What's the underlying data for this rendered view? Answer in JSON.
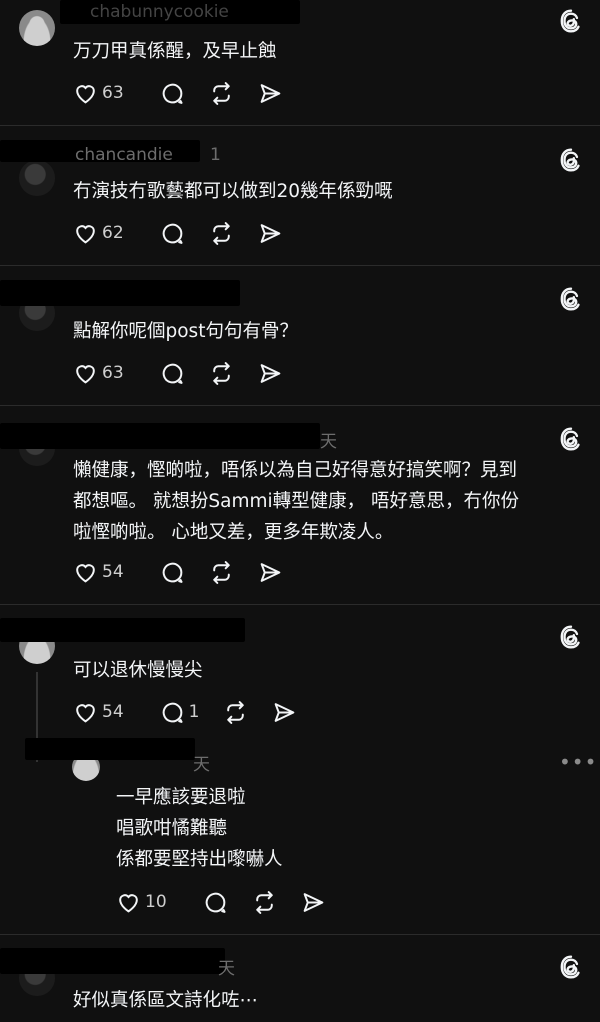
{
  "comments": [
    {
      "handle": "chabunnycookie",
      "time": "",
      "text": [
        "万刀甲真係醒，及早止蝕"
      ],
      "likes": "63",
      "replies": ""
    },
    {
      "handle": "chancandie",
      "time": "1",
      "text": [
        "冇演技冇歌藝都可以做到20幾年係勁嘅"
      ],
      "likes": "62",
      "replies": ""
    },
    {
      "handle": "",
      "time": "",
      "text": [
        "點解你呢個post句句有骨？"
      ],
      "likes": "63",
      "replies": ""
    },
    {
      "handle": "",
      "time": "天",
      "text": [
        "懶健康，慳啲啦，唔係以為自己好得意好搞笑啊？見到",
        "都想嘔。 就想扮Sammi轉型健康， 唔好意思，冇你份",
        "啦慳啲啦。 心地又差，更多年欺凌人。"
      ],
      "likes": "54",
      "replies": ""
    },
    {
      "handle": "",
      "time": "",
      "text": [
        "可以退休慢慢尖"
      ],
      "likes": "54",
      "replies": "1"
    }
  ],
  "reply": {
    "handle": "",
    "time": "天",
    "text": [
      "一早應該要退啦",
      "唱歌咁憰難聽",
      "係都要堅持出嚟嚇人"
    ],
    "likes": "10"
  },
  "last": {
    "handle": "",
    "time": "天",
    "text": [
      "好似真係區文詩化咗⋯"
    ]
  },
  "icons": {
    "like": "heart-icon",
    "reply": "comment-icon",
    "repost": "repost-icon",
    "share": "send-icon",
    "app": "threads-icon",
    "more": "more-icon"
  }
}
